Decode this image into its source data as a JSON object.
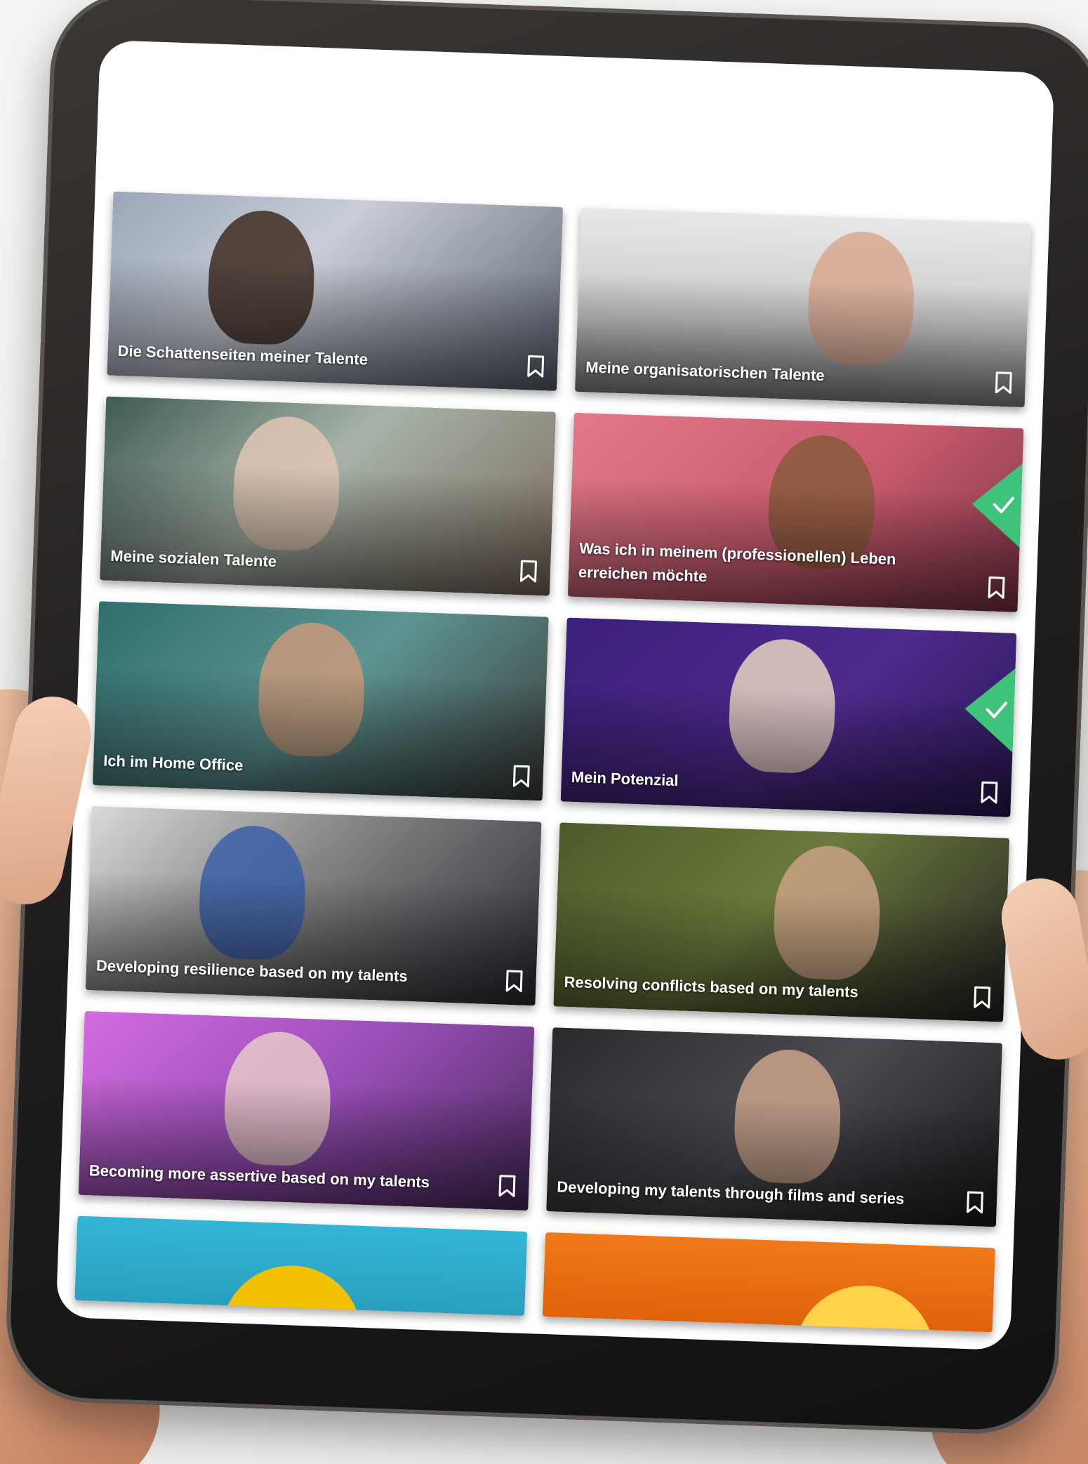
{
  "cards": [
    {
      "title": "Die Schattenseiten meiner Talente",
      "completed": false,
      "bg": "linear-gradient(135deg,#9aa6b8 0%,#c9ced8 40%,#5b6270 100%)",
      "figure": "#3e2c22"
    },
    {
      "title": "Meine organisatorischen Talente",
      "completed": false,
      "bg": "linear-gradient(180deg,#e8e8e8 0%,#c9c9c9 60%,#8c8c8c 100%)",
      "figure": "#d8a890"
    },
    {
      "title": "Meine sozialen Talente",
      "completed": false,
      "bg": "linear-gradient(135deg,#3f5b52 0%,#a7b3a9 45%,#7b6a5c 100%)",
      "figure": "#e0c5b3"
    },
    {
      "title": "Was ich in meinem (professionellen) Leben erreichen möchte",
      "completed": true,
      "bg": "linear-gradient(135deg,#e27a8a 0%,#c85a6e 55%,#7d3444 100%)",
      "figure": "#8a5a3c"
    },
    {
      "title": "Ich im Home Office",
      "completed": false,
      "bg": "linear-gradient(135deg,#2f6f6e 0%,#5d9592 50%,#3b3b3b 100%)",
      "figure": "#c79a7b"
    },
    {
      "title": "Mein Potenzial",
      "completed": true,
      "bg": "linear-gradient(135deg,#3b1f7a 0%,#4e2a8c 55%,#271650 100%)",
      "figure": "#e9d2c2"
    },
    {
      "title": "Developing resilience based on my talents",
      "completed": false,
      "bg": "linear-gradient(135deg,#d9d9d9 0%,#8a8a8a 40%,#2a2a33 100%)",
      "figure": "#3a5fa8"
    },
    {
      "title": "Resolving conflicts based on my talents",
      "completed": false,
      "bg": "linear-gradient(135deg,#4d5a2a 0%,#6b7a3c 45%,#222 100%)",
      "figure": "#c9a184"
    },
    {
      "title": "Becoming more assertive based on my talents",
      "completed": false,
      "bg": "linear-gradient(135deg,#d36be0 0%,#9a4fb8 50%,#4b2a5e 100%)",
      "figure": "#e8c9c9"
    },
    {
      "title": "Developing my talents through films and series",
      "completed": false,
      "bg": "linear-gradient(135deg,#2a2a2e 0%,#4a4a50 50%,#1a1a1d 100%)",
      "figure": "#caa58c"
    }
  ],
  "partial_cards": [
    {
      "bg": "linear-gradient(180deg,#33b6d6 0%,#2a9fc0 100%)",
      "accent": "#f2c200"
    },
    {
      "bg": "linear-gradient(180deg,#f07a1a 0%,#e0620a 100%)",
      "accent": "#ffd24a"
    }
  ],
  "colors": {
    "check_green": "#3fc27a",
    "title_text": "#ffffff"
  },
  "icons": {
    "bookmark": "bookmark-icon",
    "check": "check-icon"
  }
}
